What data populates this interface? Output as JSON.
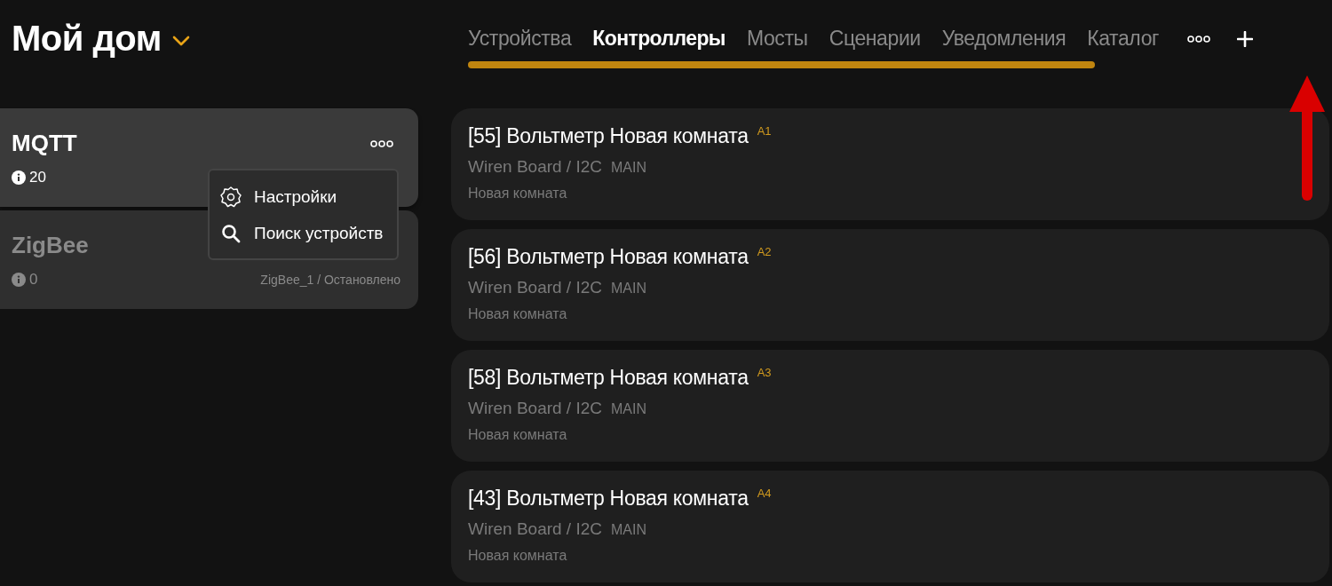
{
  "header": {
    "title": "Мой дом"
  },
  "tabs": [
    {
      "label": "Устройства",
      "selected": false
    },
    {
      "label": "Контроллеры",
      "selected": true
    },
    {
      "label": "Мосты",
      "selected": false
    },
    {
      "label": "Сценарии",
      "selected": false
    },
    {
      "label": "Уведомления",
      "selected": false
    },
    {
      "label": "Каталог",
      "selected": false
    }
  ],
  "controllers": [
    {
      "name": "MQTT",
      "count": "20",
      "selected": true,
      "active": true
    },
    {
      "name": "ZigBee",
      "count": "0",
      "status": "ZigBee_1 / Остановлено",
      "selected": false,
      "active": false
    }
  ],
  "context_menu": {
    "items": [
      {
        "kind": "settings",
        "label": "Настройки"
      },
      {
        "kind": "search",
        "label": "Поиск устройств"
      }
    ]
  },
  "devices": [
    {
      "title": "[55] Вольтметр Новая комната",
      "badge": "A1",
      "source": "Wiren Board / I2C",
      "bus": "MAIN",
      "room": "Новая комната"
    },
    {
      "title": "[56] Вольтметр Новая комната",
      "badge": "A2",
      "source": "Wiren Board / I2C",
      "bus": "MAIN",
      "room": "Новая комната"
    },
    {
      "title": "[58] Вольтметр Новая комната",
      "badge": "A3",
      "source": "Wiren Board / I2C",
      "bus": "MAIN",
      "room": "Новая комната"
    },
    {
      "title": "[43] Вольтметр Новая комната",
      "badge": "A4",
      "source": "Wiren Board / I2C",
      "bus": "MAIN",
      "room": "Новая комната"
    }
  ],
  "annotations": [
    {
      "kind": "arrow"
    }
  ]
}
